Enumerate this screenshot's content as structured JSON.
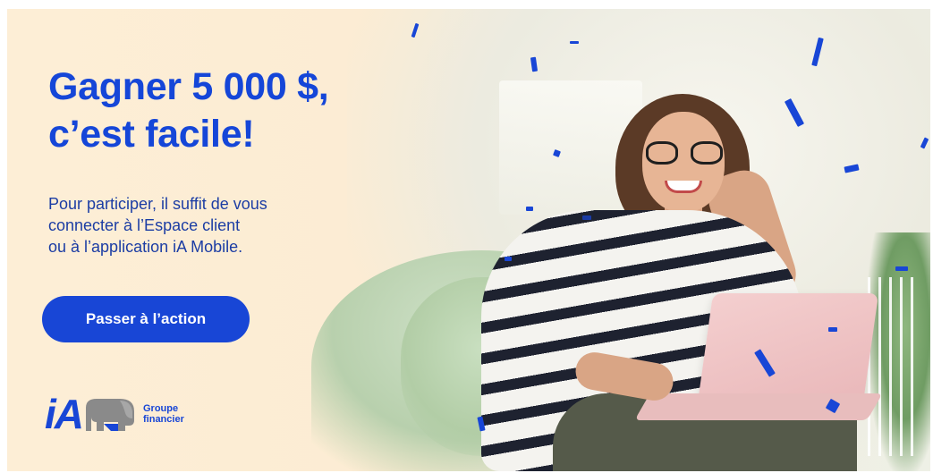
{
  "banner": {
    "headline": {
      "line1": "Gagner 5 000 $,",
      "line2": "c’est facile!"
    },
    "body": {
      "line1": "Pour participer, il suffit de vous",
      "line2": "connecter à l’Espace client",
      "line3": "ou à l’application iA Mobile."
    },
    "cta_label": "Passer à l’action",
    "logo": {
      "brand": "iA",
      "line1": "Groupe",
      "line2": "financier"
    }
  },
  "colors": {
    "brand_blue": "#1846d6",
    "headline_blue": "#1546d8",
    "body_blue": "#1c3da4",
    "background_cream": "#fdeed6"
  },
  "icons": {
    "logo_mark": "elephant-icon",
    "decoration": "confetti"
  }
}
